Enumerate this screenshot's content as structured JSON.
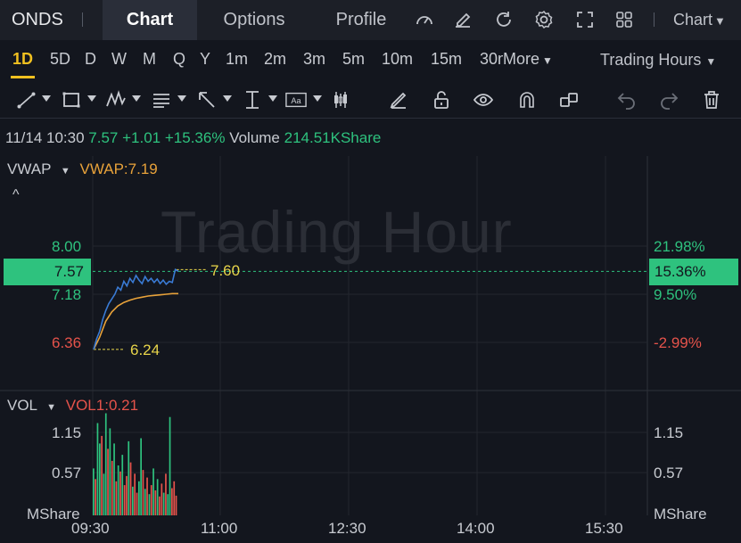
{
  "header": {
    "ticker": "ONDS",
    "tabs": [
      "Chart",
      "Options",
      "Profile"
    ],
    "active_tab": "Chart",
    "chart_dropdown": "Chart",
    "toolbar_icons": [
      "speedometer-icon",
      "edit-icon",
      "refresh-icon",
      "settings-icon",
      "fullscreen-icon",
      "grid-icon"
    ]
  },
  "periods": {
    "items": [
      "1D",
      "5D",
      "D",
      "W",
      "M",
      "Q",
      "Y",
      "1m",
      "2m",
      "3m",
      "5m",
      "10m",
      "15m",
      "30m"
    ],
    "active": "1D",
    "more_label": "More",
    "trading_hours_label": "Trading Hours"
  },
  "draw_tools": [
    "trendline-icon",
    "rectangle-icon",
    "pattern-icon",
    "fib-icon",
    "arrow-icon",
    "range-icon",
    "text-icon",
    "candle-icon",
    "pencil-icon",
    "lock-icon",
    "eye-icon",
    "magnet-icon",
    "clone-icon",
    "undo-icon",
    "redo-icon",
    "trash-icon"
  ],
  "quote": {
    "datetime": "11/14 10:30",
    "price": "7.57",
    "change": "+1.01",
    "change_pct": "+15.36%",
    "volume_label": "Volume",
    "volume": "214.51KShare"
  },
  "main_panel": {
    "indicator": "VWAP",
    "indicator_value": "VWAP:7.19",
    "watermark": "Trading Hour",
    "left_axis": [
      "8.00",
      "7.18",
      "6.36"
    ],
    "right_axis": [
      "21.98%",
      "9.50%",
      "-2.99%"
    ],
    "price_tag": "7.57",
    "pct_tag": "15.36%",
    "high_label": "7.60",
    "low_label": "6.24"
  },
  "volume_panel": {
    "indicator": "VOL",
    "indicator_value": "VOL1:0.21",
    "left_axis": [
      "1.15",
      "0.57"
    ],
    "unit": "MShare",
    "right_axis": [
      "1.15",
      "0.57"
    ],
    "right_unit": "MShare"
  },
  "x_axis": [
    "09:30",
    "11:00",
    "12:30",
    "14:00",
    "15:30"
  ],
  "colors": {
    "up": "#2ec27e",
    "down": "#e5534b",
    "price_line": "#3a7bd5",
    "vwap_line": "#e8a23a",
    "accent": "#f0c020"
  },
  "chart_data": {
    "type": "line",
    "price_series": [
      [
        0,
        6.24
      ],
      [
        1,
        6.42
      ],
      [
        2,
        6.55
      ],
      [
        3,
        6.75
      ],
      [
        4,
        6.9
      ],
      [
        5,
        7.02
      ],
      [
        6,
        7.1
      ],
      [
        7,
        7.18
      ],
      [
        8,
        7.3
      ],
      [
        9,
        7.25
      ],
      [
        10,
        7.4
      ],
      [
        11,
        7.32
      ],
      [
        12,
        7.45
      ],
      [
        13,
        7.38
      ],
      [
        14,
        7.5
      ],
      [
        15,
        7.42
      ],
      [
        16,
        7.36
      ],
      [
        17,
        7.48
      ],
      [
        18,
        7.4
      ],
      [
        19,
        7.45
      ],
      [
        20,
        7.38
      ],
      [
        21,
        7.44
      ],
      [
        22,
        7.36
      ],
      [
        23,
        7.42
      ],
      [
        24,
        7.35
      ],
      [
        25,
        7.4
      ],
      [
        26,
        7.38
      ],
      [
        27,
        7.6
      ],
      [
        28,
        7.57
      ]
    ],
    "vwap_series": [
      [
        0,
        6.24
      ],
      [
        2,
        6.45
      ],
      [
        4,
        6.72
      ],
      [
        6,
        6.88
      ],
      [
        8,
        6.98
      ],
      [
        10,
        7.04
      ],
      [
        12,
        7.08
      ],
      [
        14,
        7.11
      ],
      [
        16,
        7.13
      ],
      [
        18,
        7.15
      ],
      [
        20,
        7.16
      ],
      [
        22,
        7.17
      ],
      [
        24,
        7.18
      ],
      [
        26,
        7.19
      ],
      [
        28,
        7.19
      ]
    ],
    "volumes": [
      0.62,
      0.48,
      1.22,
      0.95,
      1.05,
      0.55,
      1.35,
      0.88,
      1.15,
      0.72,
      0.95,
      0.45,
      0.66,
      0.58,
      0.8,
      0.4,
      0.52,
      0.98,
      0.7,
      0.38,
      0.55,
      0.3,
      0.45,
      1.02,
      0.6,
      0.35,
      0.5,
      0.28,
      0.4,
      0.62,
      0.33,
      0.48,
      0.25,
      0.42,
      0.3,
      0.55,
      0.28,
      1.3,
      0.36,
      0.45,
      0.26
    ],
    "volume_up": [
      true,
      false,
      true,
      true,
      false,
      true,
      true,
      false,
      true,
      false,
      true,
      false,
      true,
      false,
      true,
      false,
      false,
      true,
      false,
      true,
      false,
      false,
      true,
      true,
      false,
      true,
      false,
      true,
      false,
      true,
      false,
      true,
      false,
      false,
      true,
      false,
      true,
      true,
      false,
      false,
      false
    ],
    "ylim": [
      6.0,
      8.3
    ],
    "vol_ylim": [
      0,
      1.45
    ],
    "x_range": [
      "09:30",
      "16:00"
    ]
  }
}
